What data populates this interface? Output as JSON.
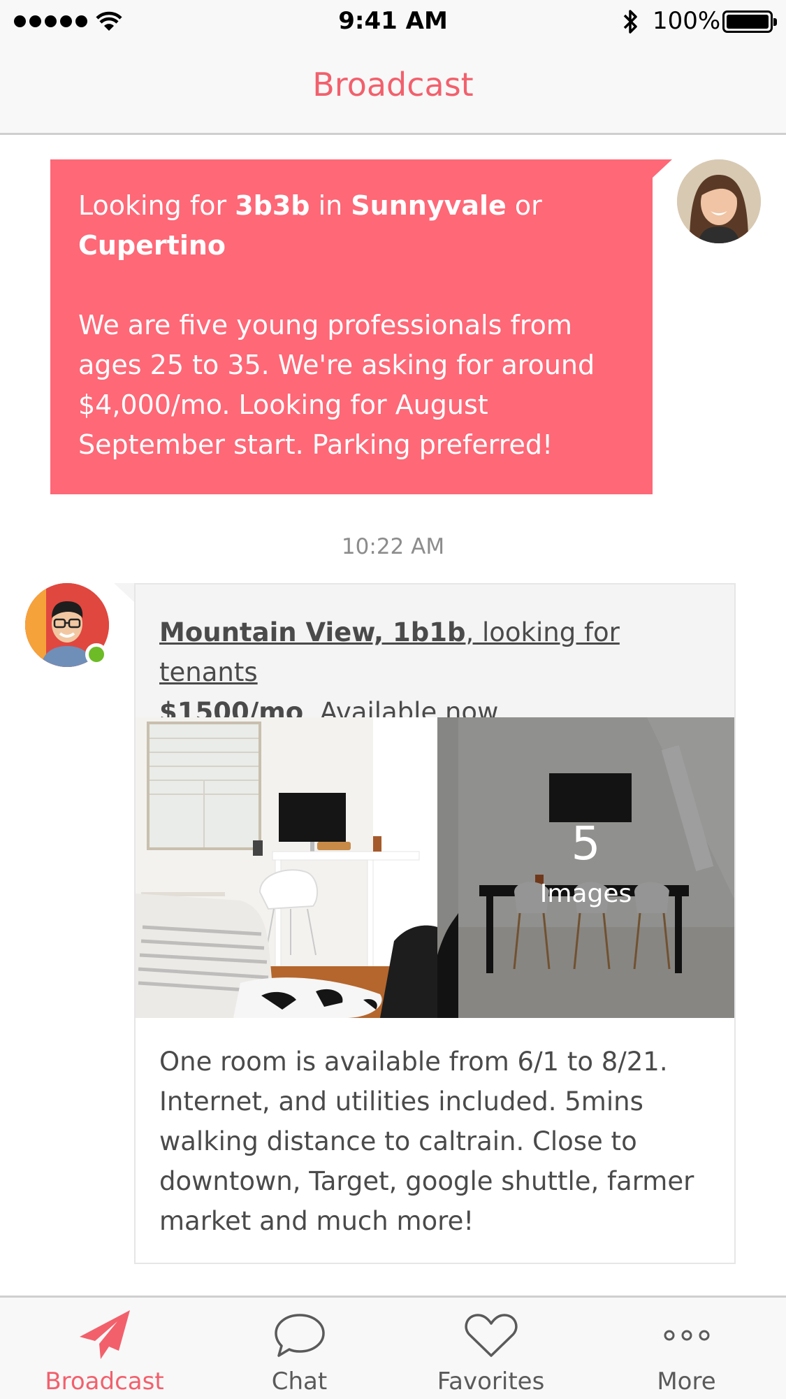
{
  "status_bar": {
    "time": "9:41 AM",
    "battery": "100%",
    "icons": [
      "signal-dots-icon",
      "wifi-icon",
      "bluetooth-icon",
      "battery-icon"
    ]
  },
  "nav": {
    "title": "Broadcast"
  },
  "colors": {
    "accent": "#fe6877",
    "title": "#f2606c",
    "online": "#6dbb26"
  },
  "sent_message": {
    "line1_prefix": "Looking for ",
    "line1_bold1": "3b3b",
    "line1_mid": " in ",
    "line1_bold2": "Sunnyvale",
    "line1_suffix": " or",
    "line2_bold": "Cupertino",
    "body": "We are five young professionals from ages 25 to 35. We're asking for around $4,000/mo. Looking for August September start. Parking preferred!"
  },
  "timestamp": "10:22 AM",
  "listing": {
    "location_bold": "Mountain View, 1b1b",
    "title_rest": ", looking for tenants",
    "price_bold": "$1500/mo",
    "availability": ", Available now",
    "image_count": "5",
    "image_count_label": "Images",
    "description": "One room is available from 6/1 to 8/21. Internet, and utilities included. 5mins walking distance to caltrain. Close to downtown, Target, google shuttle, farmer market and much more!"
  },
  "tabs": [
    {
      "label": "Broadcast",
      "icon": "paper-plane-icon",
      "active": true
    },
    {
      "label": "Chat",
      "icon": "chat-bubble-icon",
      "active": false
    },
    {
      "label": "Favorites",
      "icon": "heart-icon",
      "active": false
    },
    {
      "label": "More",
      "icon": "more-dots-icon",
      "active": false
    }
  ]
}
